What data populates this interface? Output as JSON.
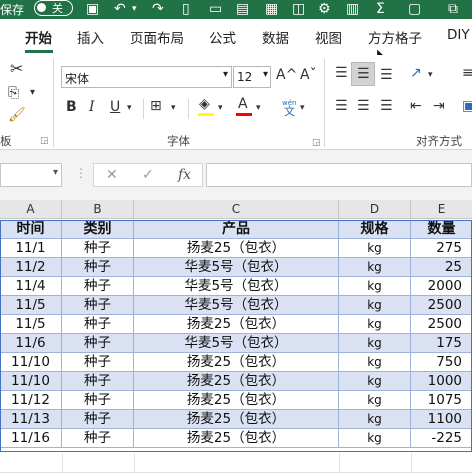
{
  "titlebar": {
    "autosave_label": "保存",
    "toggle_label": "关"
  },
  "tabs": [
    {
      "label": "开始",
      "active": true
    },
    {
      "label": "插入"
    },
    {
      "label": "页面布局"
    },
    {
      "label": "公式"
    },
    {
      "label": "数据"
    },
    {
      "label": "视图"
    },
    {
      "label": "方方格子"
    },
    {
      "label": "DIY"
    }
  ],
  "ribbon": {
    "clipboard_label": "板",
    "font_name": "宋体",
    "font_size": "12",
    "font_group_label": "字体",
    "align_group_label": "对齐方式",
    "bold": "B",
    "italic": "I",
    "underline": "U",
    "phonetic_top": "wén",
    "phonetic_bottom": "文",
    "font_color_letter": "A",
    "grow_font": "A^",
    "shrink_font": "Aˇ",
    "accent_fill": "#ffff00",
    "accent_font": "#ff0000"
  },
  "formula": {
    "cancel": "✕",
    "enter": "✓",
    "fx": "fx"
  },
  "columns": [
    "A",
    "B",
    "C",
    "D",
    "E"
  ],
  "header": {
    "a": "时间",
    "b": "类别",
    "c": "产品",
    "d": "规格",
    "e": "数量"
  },
  "rows": [
    {
      "a": "11/1",
      "b": "种子",
      "c": "扬麦25（包衣）",
      "d": "kg",
      "e": "275"
    },
    {
      "a": "11/2",
      "b": "种子",
      "c": "华麦5号（包衣）",
      "d": "kg",
      "e": "25"
    },
    {
      "a": "11/4",
      "b": "种子",
      "c": "华麦5号（包衣）",
      "d": "kg",
      "e": "2000"
    },
    {
      "a": "11/5",
      "b": "种子",
      "c": "华麦5号（包衣）",
      "d": "kg",
      "e": "2500"
    },
    {
      "a": "11/5",
      "b": "种子",
      "c": "扬麦25（包衣）",
      "d": "kg",
      "e": "2500"
    },
    {
      "a": "11/6",
      "b": "种子",
      "c": "华麦5号（包衣）",
      "d": "kg",
      "e": "175"
    },
    {
      "a": "11/10",
      "b": "种子",
      "c": "扬麦25（包衣）",
      "d": "kg",
      "e": "750"
    },
    {
      "a": "11/10",
      "b": "种子",
      "c": "扬麦25（包衣）",
      "d": "kg",
      "e": "1000"
    },
    {
      "a": "11/12",
      "b": "种子",
      "c": "扬麦25（包衣）",
      "d": "kg",
      "e": "1075"
    },
    {
      "a": "11/13",
      "b": "种子",
      "c": "扬麦25（包衣）",
      "d": "kg",
      "e": "1100"
    },
    {
      "a": "11/16",
      "b": "种子",
      "c": "扬麦25（包衣）",
      "d": "kg",
      "e": "-225"
    }
  ],
  "colors": {
    "excel_green": "#217346",
    "selection_fill": "#d9e1f2",
    "selection_border": "#4472c4"
  }
}
